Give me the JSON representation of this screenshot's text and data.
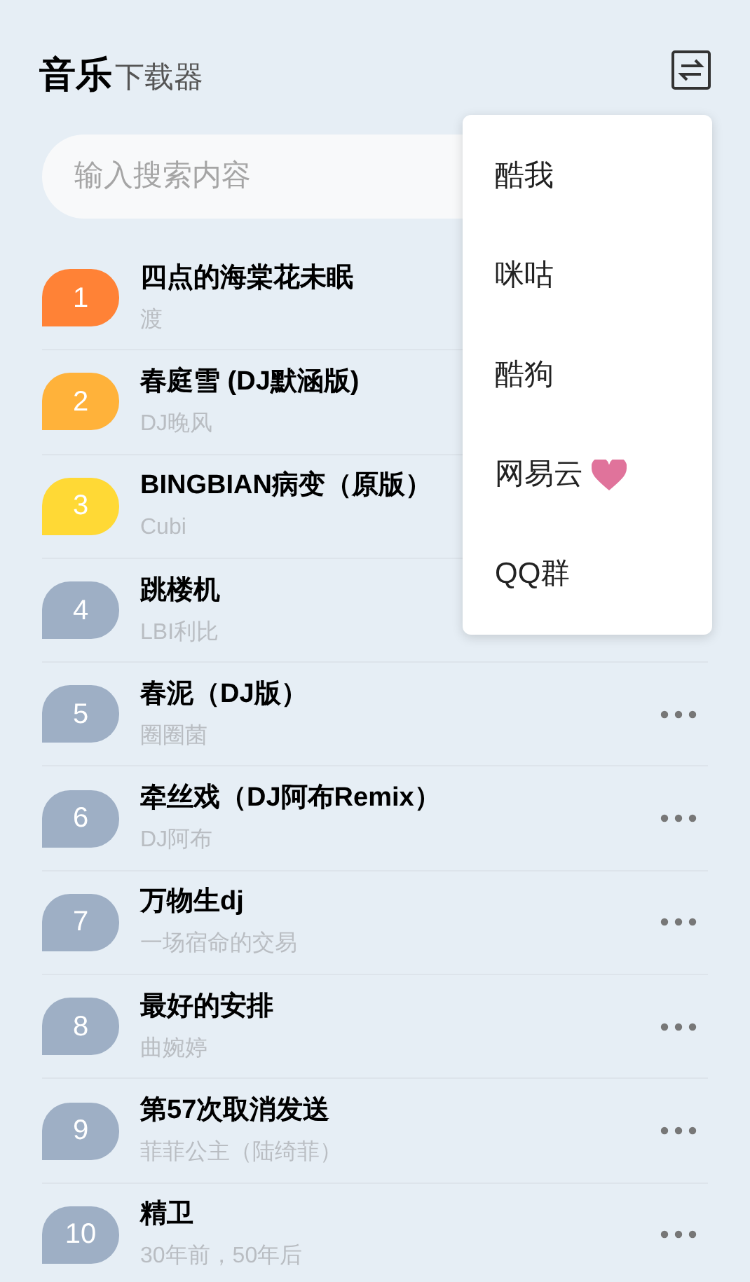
{
  "header": {
    "title": "音乐",
    "subtitle": "下载器"
  },
  "search": {
    "placeholder": "输入搜索内容"
  },
  "songs": [
    {
      "rank": "1",
      "color": "#ff8236",
      "title": "四点的海棠花未眠",
      "artist": "渡",
      "more": false
    },
    {
      "rank": "2",
      "color": "#ffb23a",
      "title": "春庭雪 (DJ默涵版)",
      "artist": "DJ晚风",
      "more": false
    },
    {
      "rank": "3",
      "color": "#ffd935",
      "title": "BINGBIAN病变（原版）",
      "artist": "Cubi",
      "more": false
    },
    {
      "rank": "4",
      "color": "#9eafc5",
      "title": "跳楼机",
      "artist": "LBI利比",
      "more": false
    },
    {
      "rank": "5",
      "color": "#9eafc5",
      "title": "春泥（DJ版）",
      "artist": "圈圈菌",
      "more": true
    },
    {
      "rank": "6",
      "color": "#9eafc5",
      "title": "牵丝戏（DJ阿布Remix）",
      "artist": "DJ阿布",
      "more": true
    },
    {
      "rank": "7",
      "color": "#9eafc5",
      "title": "万物生dj",
      "artist": "一场宿命的交易",
      "more": true
    },
    {
      "rank": "8",
      "color": "#9eafc5",
      "title": "最好的安排",
      "artist": "曲婉婷",
      "more": true
    },
    {
      "rank": "9",
      "color": "#9eafc5",
      "title": "第57次取消发送",
      "artist": "菲菲公主（陆绮菲）",
      "more": true
    },
    {
      "rank": "10",
      "color": "#9eafc5",
      "title": "精卫",
      "artist": "30年前，50年后",
      "more": true
    }
  ],
  "menu": [
    {
      "label": "酷我",
      "favorite": false
    },
    {
      "label": "咪咕",
      "favorite": false
    },
    {
      "label": "酷狗",
      "favorite": false
    },
    {
      "label": "网易云",
      "favorite": true
    },
    {
      "label": "QQ群",
      "favorite": false
    }
  ]
}
